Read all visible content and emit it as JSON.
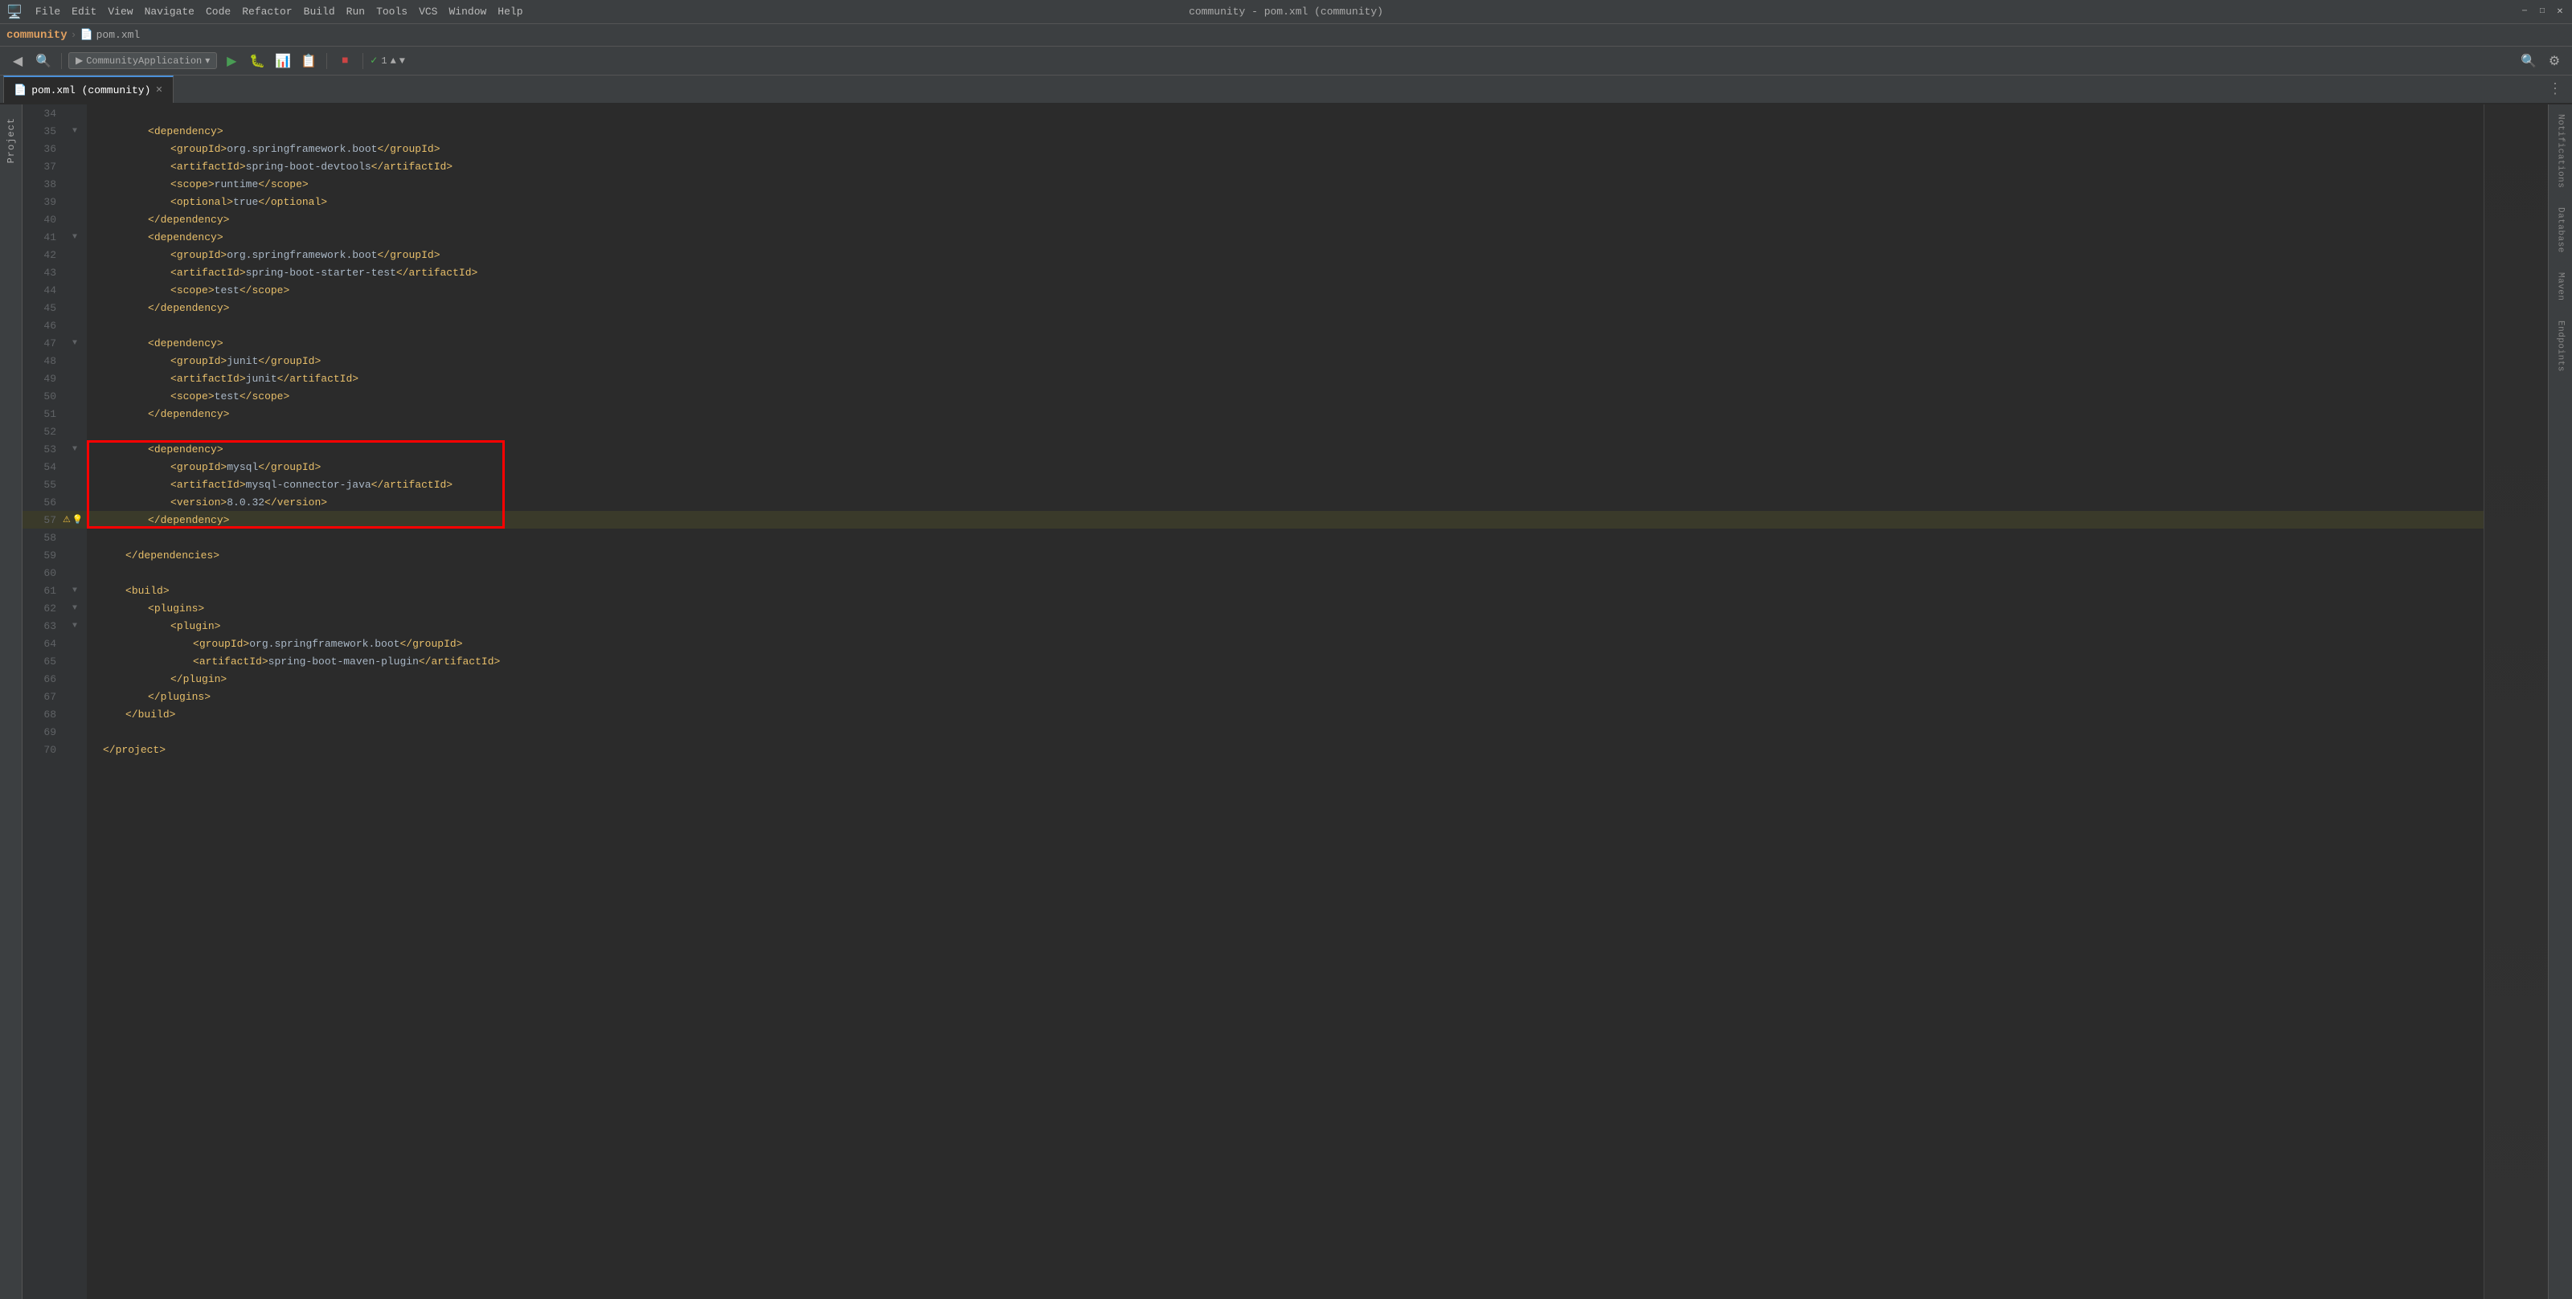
{
  "window": {
    "title": "community - pom.xml (community)"
  },
  "title_bar": {
    "menu_items": [
      "File",
      "Edit",
      "View",
      "Navigate",
      "Code",
      "Refactor",
      "Build",
      "Run",
      "Tools",
      "VCS",
      "Window",
      "Help"
    ],
    "project_name": "community",
    "file_icon": "📄",
    "file_name": "pom.xml",
    "run_config": "CommunityApplication",
    "window_controls": [
      "─",
      "□",
      "✕"
    ]
  },
  "tabs": [
    {
      "label": "pom.xml (community)",
      "active": true,
      "icon": "📄"
    }
  ],
  "right_sidebar_items": [
    "Notifications",
    "Database",
    "Maven",
    "Endpoints"
  ],
  "left_sidebar_items": [
    "Project"
  ],
  "toolbar": {
    "error_count": "1",
    "run_label": "CommunityApplication"
  },
  "code": {
    "lines": [
      {
        "num": 34,
        "indent": 0,
        "content": ""
      },
      {
        "num": 35,
        "indent": 2,
        "content": "<dependency>",
        "type": "open-tag"
      },
      {
        "num": 36,
        "indent": 3,
        "content": "<groupId>org.springframework.boot</groupId>",
        "groupId": "org.springframework.boot"
      },
      {
        "num": 37,
        "indent": 3,
        "content": "<artifactId>spring-boot-devtools</artifactId>",
        "artifactId": "spring-boot-devtools"
      },
      {
        "num": 38,
        "indent": 3,
        "content": "<scope>runtime</scope>",
        "value": "runtime"
      },
      {
        "num": 39,
        "indent": 3,
        "content": "<optional>true</optional>",
        "value": "true"
      },
      {
        "num": 40,
        "indent": 2,
        "content": "</dependency>",
        "type": "close-tag"
      },
      {
        "num": 41,
        "indent": 2,
        "content": "<dependency>",
        "type": "open-tag"
      },
      {
        "num": 42,
        "indent": 3,
        "content": "<groupId>org.springframework.boot</groupId>",
        "groupId": "org.springframework.boot"
      },
      {
        "num": 43,
        "indent": 3,
        "content": "<artifactId>spring-boot-starter-test</artifactId>",
        "artifactId": "spring-boot-starter-test"
      },
      {
        "num": 44,
        "indent": 3,
        "content": "<scope>test</scope>",
        "value": "test"
      },
      {
        "num": 45,
        "indent": 2,
        "content": "</dependency>",
        "type": "close-tag"
      },
      {
        "num": 46,
        "indent": 0,
        "content": ""
      },
      {
        "num": 47,
        "indent": 2,
        "content": "<dependency>",
        "type": "open-tag"
      },
      {
        "num": 48,
        "indent": 3,
        "content": "<groupId>junit</groupId>",
        "groupId": "junit"
      },
      {
        "num": 49,
        "indent": 3,
        "content": "<artifactId>junit</artifactId>",
        "artifactId": "junit"
      },
      {
        "num": 50,
        "indent": 3,
        "content": "<scope>test</scope>",
        "value": "test"
      },
      {
        "num": 51,
        "indent": 2,
        "content": "</dependency>",
        "type": "close-tag"
      },
      {
        "num": 52,
        "indent": 0,
        "content": ""
      },
      {
        "num": 53,
        "indent": 2,
        "content": "<dependency>",
        "type": "open-tag",
        "selected": true
      },
      {
        "num": 54,
        "indent": 3,
        "content": "<groupId>mysql</groupId>",
        "groupId": "mysql",
        "selected": true
      },
      {
        "num": 55,
        "indent": 3,
        "content": "<artifactId>mysql-connector-java</artifactId>",
        "artifactId": "mysql-connector-java",
        "selected": true
      },
      {
        "num": 56,
        "indent": 3,
        "content": "<version>8.0.32</version>",
        "value": "8.0.32",
        "selected": true
      },
      {
        "num": 57,
        "indent": 2,
        "content": "</dependency>",
        "type": "close-tag",
        "selected": true,
        "warn": true
      },
      {
        "num": 58,
        "indent": 0,
        "content": ""
      },
      {
        "num": 59,
        "indent": 1,
        "content": "</dependencies>",
        "type": "close-tag"
      },
      {
        "num": 60,
        "indent": 0,
        "content": ""
      },
      {
        "num": 61,
        "indent": 1,
        "content": "<build>",
        "type": "open-tag"
      },
      {
        "num": 62,
        "indent": 2,
        "content": "<plugins>",
        "type": "open-tag"
      },
      {
        "num": 63,
        "indent": 2,
        "content": "<plugin>",
        "type": "open-tag"
      },
      {
        "num": 64,
        "indent": 3,
        "content": "<groupId>org.springframework.boot</groupId>",
        "groupId": "org.springframework.boot"
      },
      {
        "num": 65,
        "indent": 3,
        "content": "<artifactId>spring-boot-maven-plugin</artifactId>",
        "artifactId": "spring-boot-maven-plugin"
      },
      {
        "num": 66,
        "indent": 2,
        "content": "</plugin>",
        "type": "close-tag"
      },
      {
        "num": 67,
        "indent": 2,
        "content": "</plugins>",
        "type": "close-tag"
      },
      {
        "num": 68,
        "indent": 1,
        "content": "</build>",
        "type": "close-tag"
      },
      {
        "num": 69,
        "indent": 0,
        "content": ""
      },
      {
        "num": 70,
        "indent": 0,
        "content": "</project>",
        "type": "close-tag"
      }
    ]
  }
}
